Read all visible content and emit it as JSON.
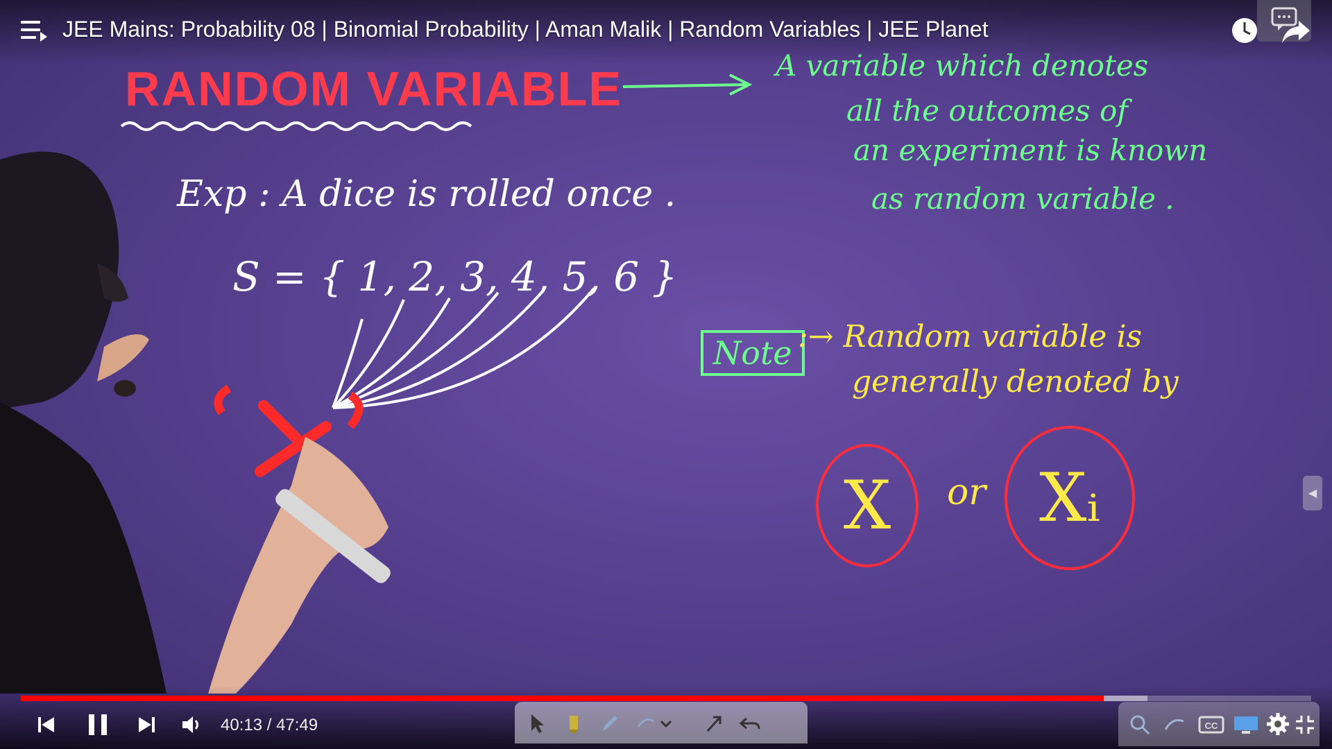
{
  "header": {
    "title": "JEE Mains: Probability 08 | Binomial Probability | Aman Malik | Random Variables | JEE Planet"
  },
  "board": {
    "heading": "RANDOM VARIABLE",
    "definition_lines": [
      "A variable which denotes",
      "all the outcomes of",
      "an experiment is known",
      "as random variable ."
    ],
    "experiment": "Exp :  A  dice  is  rolled  once .",
    "sample_space": "S = { 1, 2, 3, 4, 5, 6 }",
    "note_label": "Note",
    "note_lines": [
      ":→ Random  variable  is",
      "generally  denoted  by"
    ],
    "symbol_x": "X",
    "or_text": "or",
    "symbol_xi": "Xᵢ",
    "red_x": "X"
  },
  "player": {
    "current_time": "40:13",
    "duration": "47:49",
    "time_display": "40:13 / 47:49",
    "progress_fraction": 0.8394,
    "buffer_fraction": 0.8731,
    "colors": {
      "played": "#ff0000",
      "board_green": "#6dff8e",
      "board_yellow": "#ffe94a",
      "board_red": "#ff3b4d"
    }
  },
  "icons": {
    "menu": "playlist-menu-icon",
    "watch_later": "clock-icon",
    "share": "share-icon",
    "chat": "chat-icon",
    "prev": "previous-icon",
    "pause": "pause-icon",
    "next": "next-icon",
    "volume": "volume-icon",
    "cursor": "pointer-tool-icon",
    "highlighter": "highlighter-icon",
    "pen": "pen-icon",
    "shape": "shape-icon",
    "arrow": "arrow-tool-icon",
    "undo": "undo-icon",
    "captions": "cc-icon",
    "settings": "gear-icon",
    "fullscreen_exit": "exit-fullscreen-icon"
  }
}
